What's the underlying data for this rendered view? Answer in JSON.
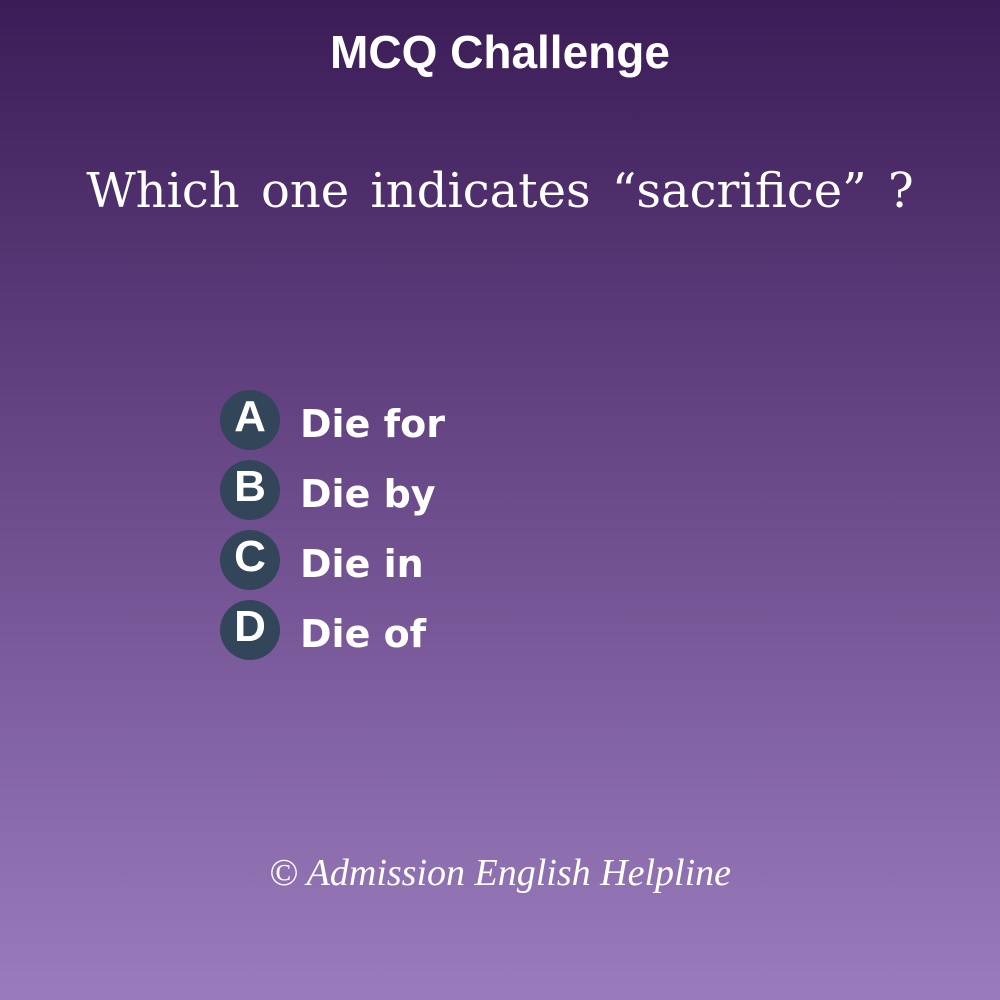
{
  "header": {
    "title": "MCQ Challenge"
  },
  "question": {
    "text": "Which one indicates “sacrifice” ?"
  },
  "options": [
    {
      "letter": "A",
      "text": "Die for"
    },
    {
      "letter": "B",
      "text": "Die by"
    },
    {
      "letter": "C",
      "text": "Die in"
    },
    {
      "letter": "D",
      "text": "Die of"
    }
  ],
  "footer": {
    "copyright": "© Admission English Helpline"
  },
  "colors": {
    "background_top": "#3b1c57",
    "background_bottom": "#9a7cbd",
    "badge": "#324559",
    "text": "#ffffff"
  }
}
